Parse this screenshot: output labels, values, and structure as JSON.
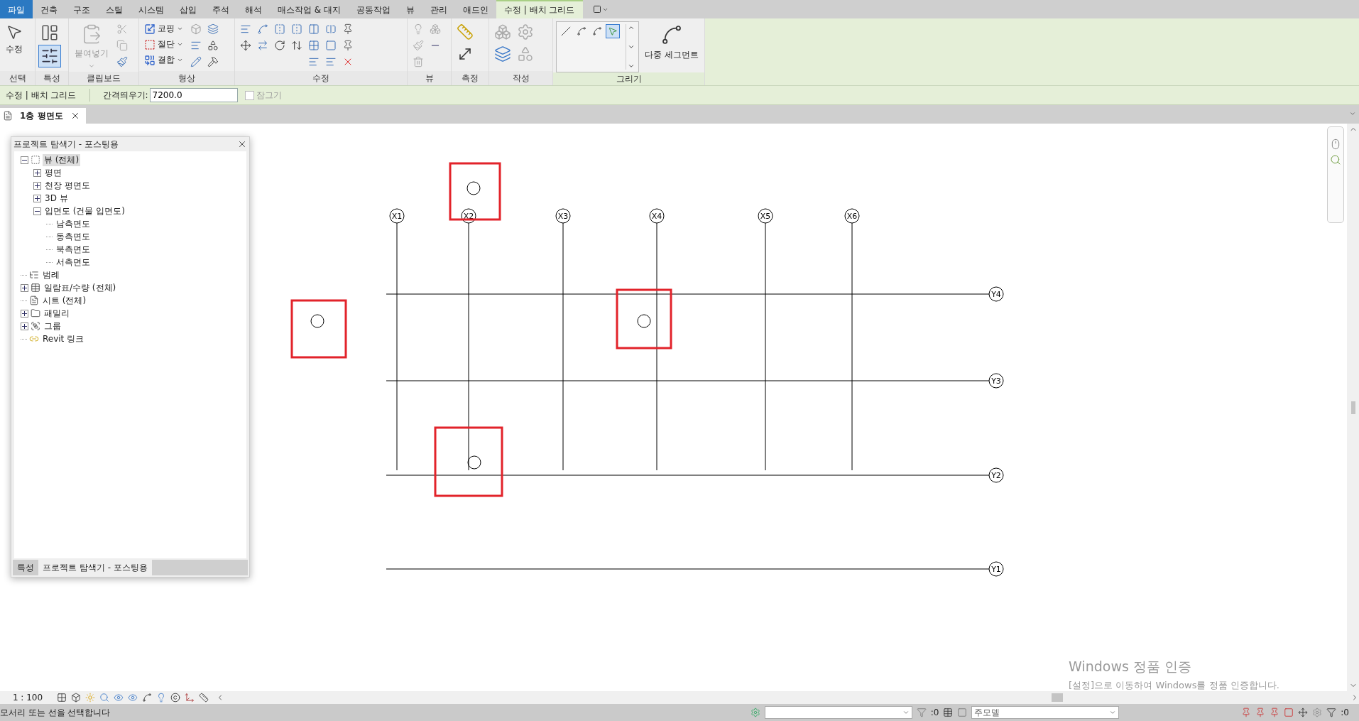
{
  "tabs": [
    {
      "label": "파일",
      "kind": "application",
      "selected": false
    },
    {
      "label": "건축",
      "kind": "normal",
      "selected": false
    },
    {
      "label": "구조",
      "kind": "normal",
      "selected": false
    },
    {
      "label": "스틸",
      "kind": "normal",
      "selected": false
    },
    {
      "label": "시스템",
      "kind": "normal",
      "selected": false
    },
    {
      "label": "삽입",
      "kind": "normal",
      "selected": false
    },
    {
      "label": "주석",
      "kind": "normal",
      "selected": false
    },
    {
      "label": "해석",
      "kind": "normal",
      "selected": false
    },
    {
      "label": "매스작업 & 대지",
      "kind": "normal",
      "selected": false
    },
    {
      "label": "공동작업",
      "kind": "normal",
      "selected": false
    },
    {
      "label": "뷰",
      "kind": "normal",
      "selected": false
    },
    {
      "label": "관리",
      "kind": "normal",
      "selected": false
    },
    {
      "label": "애드인",
      "kind": "normal",
      "selected": false
    },
    {
      "label": "수정 | 배치 그리드",
      "kind": "contextual",
      "selected": true
    }
  ],
  "ribbon": {
    "panels": [
      {
        "kind": "select",
        "label": "선택",
        "contextual": false,
        "buttons": [
          {
            "label": "수정",
            "disabled": false
          }
        ]
      },
      {
        "kind": "properties",
        "label": "특성",
        "contextual": false
      },
      {
        "kind": "clipboard",
        "label": "클립보드",
        "contextual": false,
        "buttons": [
          {
            "label": "붙여넣기",
            "disabled": true
          }
        ]
      },
      {
        "kind": "geometry",
        "label": "형상",
        "contextual": false,
        "buttons": [
          {
            "label": "코핑",
            "disabled": false
          },
          {
            "label": "절단",
            "disabled": false
          },
          {
            "label": "결합",
            "disabled": false
          }
        ]
      },
      {
        "kind": "modify",
        "label": "수정",
        "contextual": false
      },
      {
        "kind": "view",
        "label": "뷰",
        "contextual": false
      },
      {
        "kind": "measure",
        "label": "측정",
        "contextual": false
      },
      {
        "kind": "create",
        "label": "작성",
        "contextual": false
      },
      {
        "kind": "draw",
        "label": "그리기",
        "contextual": true,
        "buttons": [
          {
            "label": "다중 세그먼트",
            "disabled": false
          }
        ]
      }
    ]
  },
  "options_bar": {
    "title": "수정 | 배치 그리드",
    "offset_label": "간격띄우기:",
    "offset_value": "7200.0",
    "lock": {
      "label": "잠그기",
      "checked": false
    }
  },
  "doc_tab": {
    "title": "1층 평면도"
  },
  "browser": {
    "title": "프로젝트 탐색기 - 포스팅용",
    "tree": [
      {
        "label": "뷰 (전체)",
        "kind": "views",
        "expanded": true,
        "selected": true,
        "children": [
          {
            "label": "평면",
            "expanded": false,
            "selected": false
          },
          {
            "label": "천장 평면도",
            "expanded": false,
            "selected": false
          },
          {
            "label": "3D 뷰",
            "expanded": false,
            "selected": false
          },
          {
            "label": "입면도 (건물 입면도)",
            "expanded": true,
            "selected": false,
            "children": [
              {
                "label": "남측면도",
                "selected": false
              },
              {
                "label": "동측면도",
                "selected": false
              },
              {
                "label": "북측면도",
                "selected": false
              },
              {
                "label": "서측면도",
                "selected": false
              }
            ]
          }
        ]
      },
      {
        "label": "범례",
        "kind": "legends",
        "selected": false
      },
      {
        "label": "일람표/수량 (전체)",
        "kind": "schedules",
        "expanded": false,
        "selected": false
      },
      {
        "label": "시트 (전체)",
        "kind": "sheets",
        "selected": false
      },
      {
        "label": "패밀리",
        "kind": "families",
        "expanded": false,
        "selected": false
      },
      {
        "label": "그룹",
        "kind": "groups",
        "expanded": false,
        "selected": false
      },
      {
        "label": "Revit 링크",
        "kind": "links",
        "selected": false
      }
    ],
    "tabs": [
      {
        "label": "특성",
        "selected": false
      },
      {
        "label": "프로젝트 탐색기 - 포스팅용",
        "selected": true
      }
    ]
  },
  "grids": {
    "vertical": [
      "X1",
      "X2",
      "X3",
      "X4",
      "X5",
      "X6"
    ],
    "horizontal": [
      "Y4",
      "Y3",
      "Y2",
      "Y1"
    ]
  },
  "view_bar": {
    "scale": "1 : 100"
  },
  "status_bar": {
    "message": "모서리 또는 선을 선택합니다",
    "selection_count": ":0",
    "model": "주모델",
    "filter_count": ":0"
  },
  "activation_notice": {
    "title": "Windows 정품 인증",
    "message": "[설정]으로 이동하여 Windows를 정품 인증합니다."
  }
}
